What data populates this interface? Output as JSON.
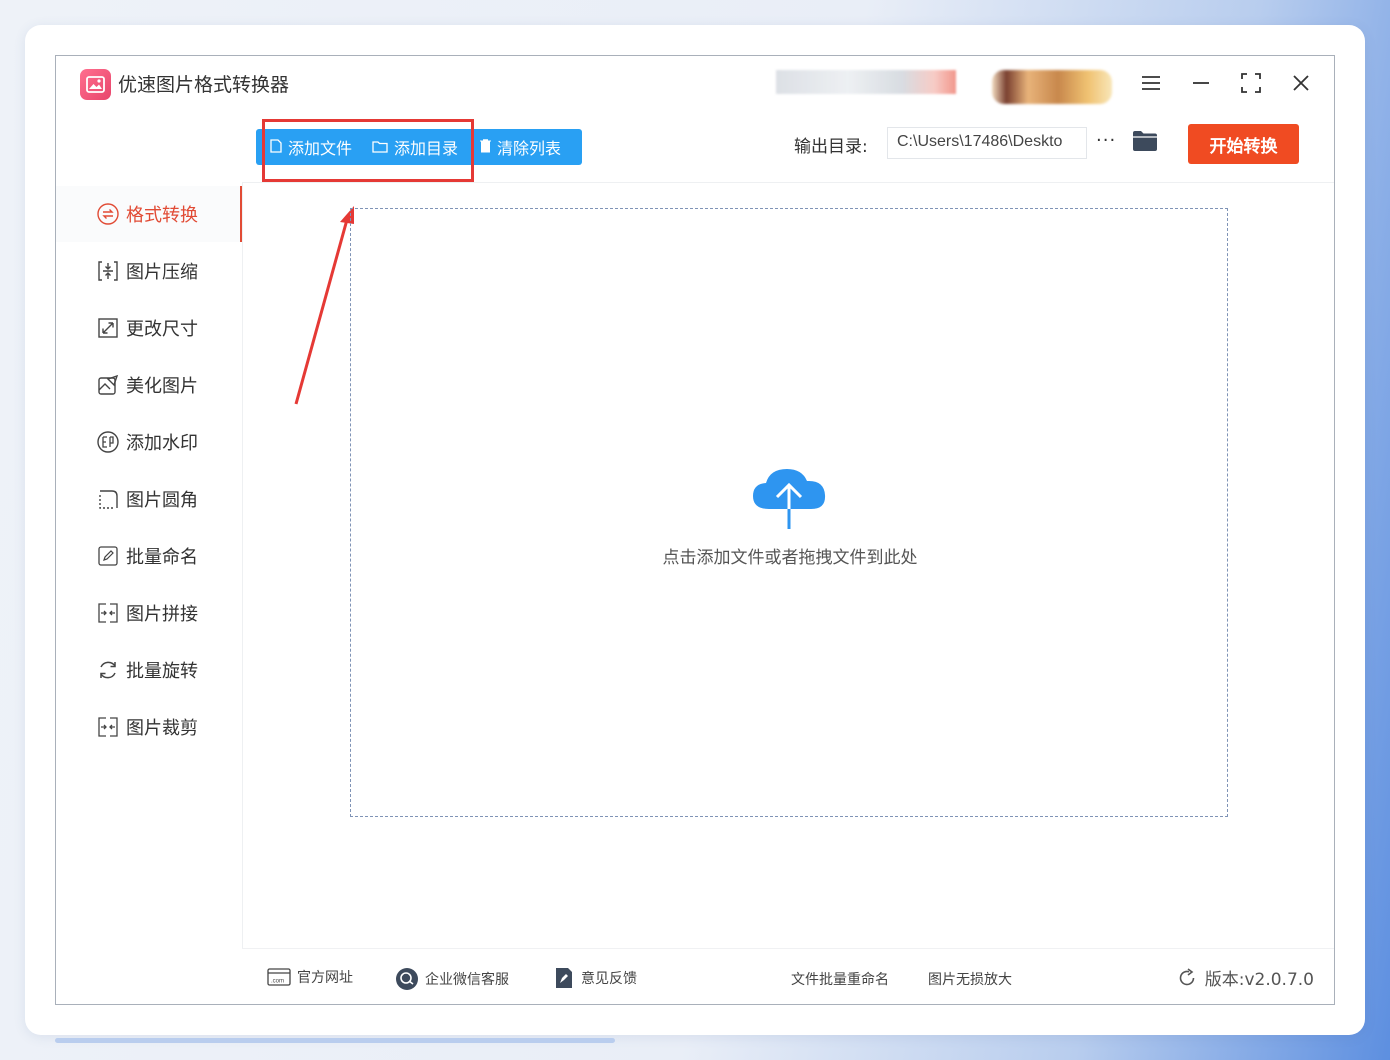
{
  "app": {
    "title": "优速图片格式转换器"
  },
  "toolbar": {
    "add_file": "添加文件",
    "add_folder": "添加目录",
    "clear_list": "清除列表",
    "output_label": "输出目录:",
    "output_path": "C:\\Users\\17486\\Deskto",
    "more": "···",
    "start": "开始转换"
  },
  "sidebar": {
    "items": [
      {
        "label": "格式转换",
        "icon": "convert-icon",
        "active": true
      },
      {
        "label": "图片压缩",
        "icon": "compress-icon"
      },
      {
        "label": "更改尺寸",
        "icon": "resize-icon"
      },
      {
        "label": "美化图片",
        "icon": "beautify-icon"
      },
      {
        "label": "添加水印",
        "icon": "watermark-icon"
      },
      {
        "label": "图片圆角",
        "icon": "round-corner-icon"
      },
      {
        "label": "批量命名",
        "icon": "rename-icon"
      },
      {
        "label": "图片拼接",
        "icon": "splice-icon"
      },
      {
        "label": "批量旋转",
        "icon": "rotate-icon"
      },
      {
        "label": "图片裁剪",
        "icon": "crop-icon"
      }
    ]
  },
  "dropzone": {
    "hint": "点击添加文件或者拖拽文件到此处"
  },
  "footer": {
    "website": "官方网址",
    "wechat": "企业微信客服",
    "feedback": "意见反馈",
    "batch_rename": "文件批量重命名",
    "upscale": "图片无损放大",
    "version": "版本:v2.0.7.0"
  },
  "colors": {
    "accent_blue": "#29a0f3",
    "start_button": "#f04b22",
    "active_nav": "#e14b35",
    "highlight": "#e53935"
  }
}
